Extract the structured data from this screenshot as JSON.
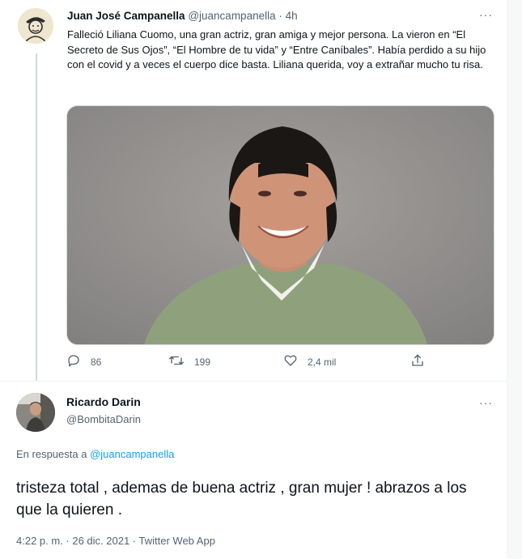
{
  "tweet1": {
    "author_name": "Juan José Campanella",
    "author_handle": "@juancampanella",
    "separator": "·",
    "time": "4h",
    "more": "···",
    "text": "Falleció Liliana Cuomo, una gran actriz, gran amiga  y mejor persona. La vieron en “El Secreto de Sus Ojos”, “El Hombre de tu vida” y “Entre Caníbales”. Había perdido a su hijo con el covid y a veces el cuerpo dice basta. Liliana querida, voy a extrañar mucho tu risa.",
    "actions": {
      "replies": "86",
      "retweets": "199",
      "likes": "2,4 mil"
    }
  },
  "tweet2": {
    "author_name": "Ricardo Darin",
    "author_handle": "@BombitaDarin",
    "more": "···",
    "reply_prefix": "En respuesta a",
    "reply_to": "@juancampanella",
    "text": "tristeza total , ademas de buena actriz , gran mujer ! abrazos a los que la quieren .",
    "timestamp": "4:22 p. m. · 26 dic. 2021 · Twitter Web App"
  },
  "colors": {
    "link": "#1d9bf0",
    "muted": "#536471",
    "text": "#0f1419"
  },
  "icons": [
    "reply-icon",
    "retweet-icon",
    "like-icon",
    "share-icon",
    "more-icon"
  ]
}
